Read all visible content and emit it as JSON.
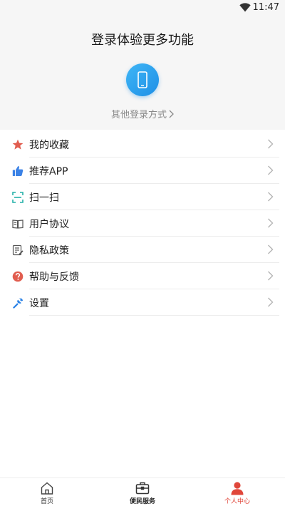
{
  "status": {
    "time": "11:47"
  },
  "login": {
    "title": "登录体验更多功能",
    "other_methods": "其他登录方式"
  },
  "menu": {
    "items": [
      {
        "label": "我的收藏",
        "icon": "star-icon",
        "color": "#e15d4f"
      },
      {
        "label": "推荐APP",
        "icon": "thumbs-up-icon",
        "color": "#3b82e6"
      },
      {
        "label": "扫一扫",
        "icon": "scan-icon",
        "color": "#23b0a8"
      },
      {
        "label": "用户协议",
        "icon": "book-icon",
        "color": "#555555"
      },
      {
        "label": "隐私政策",
        "icon": "policy-icon",
        "color": "#555555"
      },
      {
        "label": "帮助与反馈",
        "icon": "help-icon",
        "color": "#e15d4f"
      },
      {
        "label": "设置",
        "icon": "settings-icon",
        "color": "#2c83e6"
      }
    ]
  },
  "nav": {
    "home": "首页",
    "service": "便民服务",
    "me": "个人中心",
    "active_color": "#e0463a"
  }
}
